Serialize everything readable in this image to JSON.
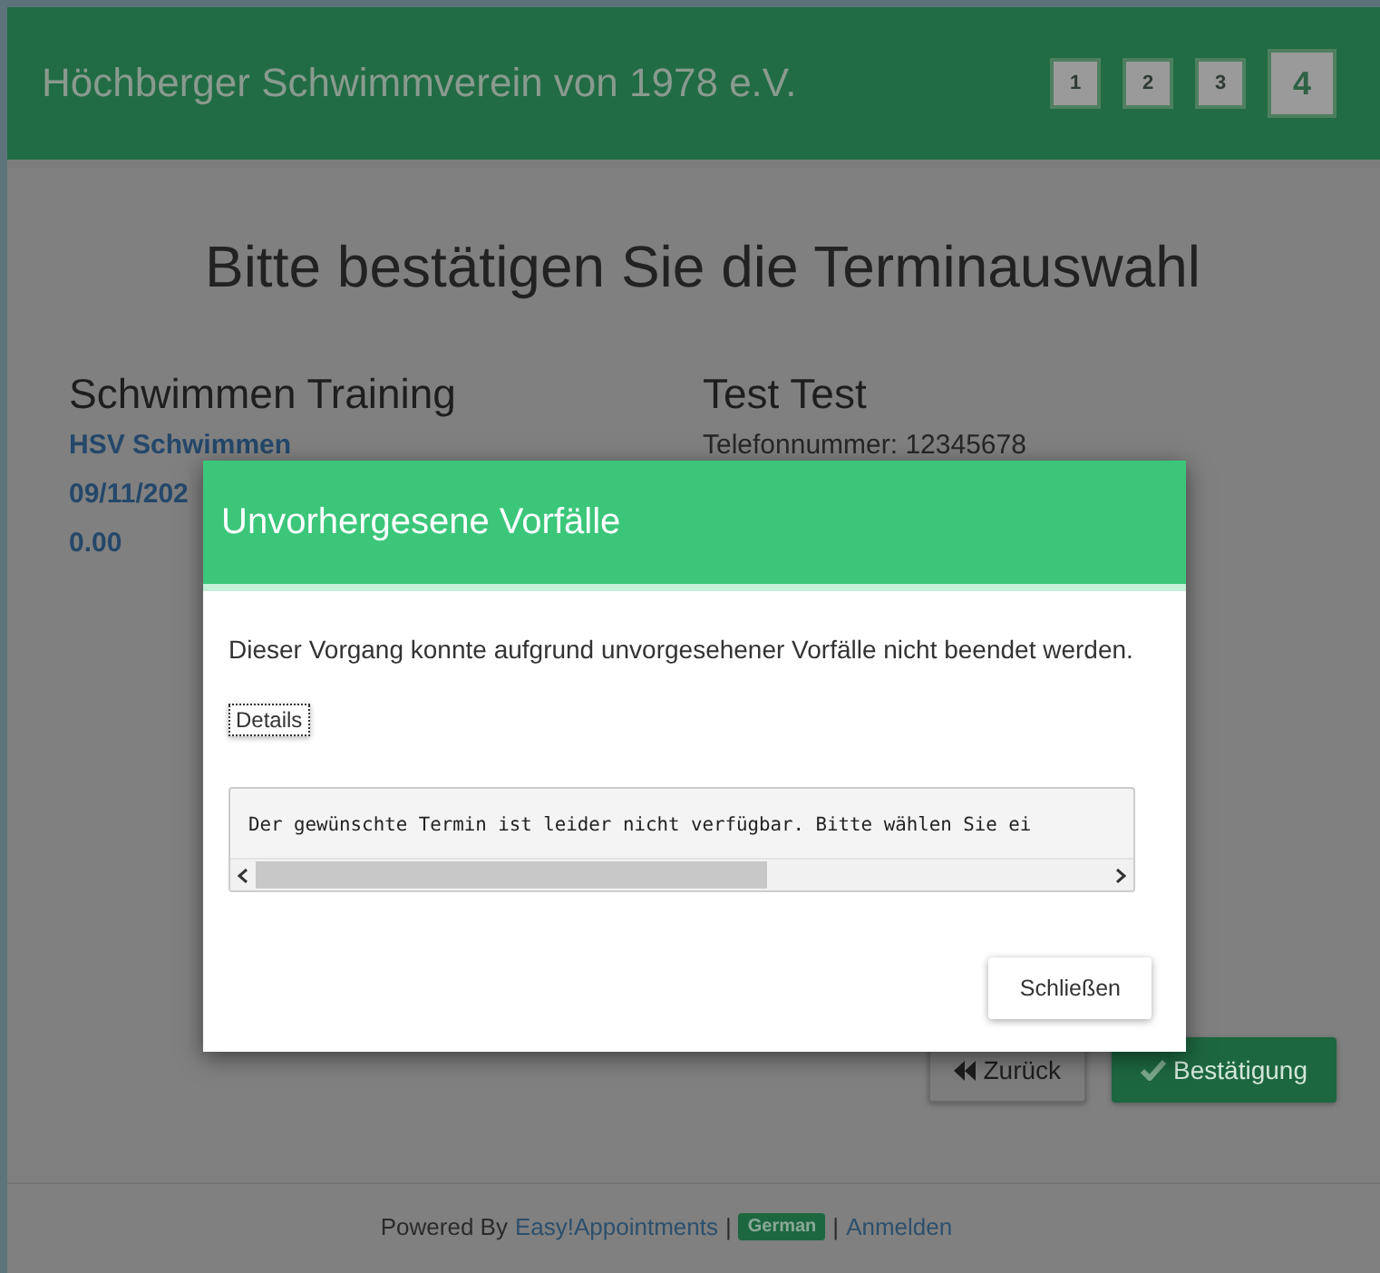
{
  "header": {
    "title": "Höchberger Schwimmverein von 1978 e.V.",
    "steps": [
      {
        "label": "1",
        "selected": false
      },
      {
        "label": "2",
        "selected": false
      },
      {
        "label": "3",
        "selected": false
      },
      {
        "label": "4",
        "selected": true
      }
    ]
  },
  "page_title": "Bitte bestätigen Sie die Terminauswahl",
  "appointment": {
    "heading": "Schwimmen Training",
    "lines": [
      "HSV Schwimmen",
      "09/11/202",
      "0.00"
    ]
  },
  "customer": {
    "heading": "Test Test",
    "lines": [
      "Telefonnummer: 12345678"
    ]
  },
  "buttons": [
    {
      "label": "Zurück",
      "kind": "back"
    },
    {
      "label": "Bestätigung",
      "kind": "confirm"
    }
  ],
  "footer": {
    "prefix": "Powered By",
    "link": "Easy!Appointments",
    "separator_1": "|",
    "language": "German",
    "separator_2": "|",
    "login": "Anmelden"
  },
  "dialog": {
    "title": "Unvorhergesene Vorfälle",
    "message": "Dieser Vorgang konnte aufgrund unvorgesehener Vorfälle nicht beendet werden.",
    "details_button": "Details",
    "details_text": "Der gewünschte Termin ist leider nicht verfügbar. Bitte wählen Sie ei",
    "close_button": "Schließen"
  }
}
